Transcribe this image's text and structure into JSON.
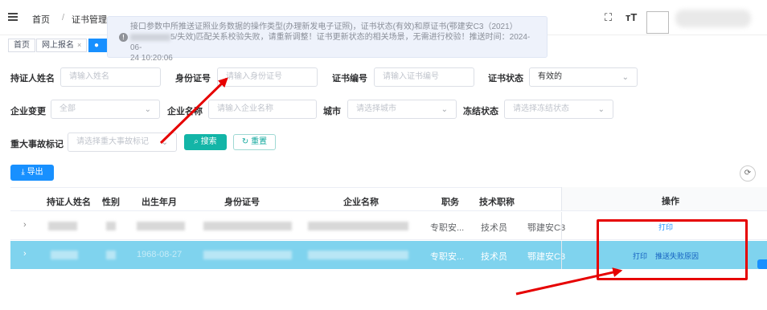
{
  "header": {
    "breadcrumb": [
      "首页",
      "/",
      "证书管理"
    ],
    "fullscreen_icon": "fullscreen-icon",
    "font_size_icon": "font-size-icon"
  },
  "tags": [
    {
      "label": "首页"
    },
    {
      "label": "网上报名",
      "close": "×"
    },
    {
      "label": "●"
    }
  ],
  "notification": {
    "line1": "接口参数中所推送证照业务数据的操作类型(办理新发电子证照)，证书状态(有效)和原证书(",
    "line1_tail": "鄂建安C3（2021）",
    "line2": "5/失效)匹配关系校验失败，请重新调整！证书更新状态的相关场景，无需进行校验！推送时间：2024-06-",
    "line3": "24 10:20:06"
  },
  "search": {
    "holder_name_label": "持证人姓名",
    "holder_name_placeholder": "请输入姓名",
    "id_label": "身份证号",
    "id_placeholder": "请输入身份证号",
    "cert_no_label": "证书编号",
    "cert_no_placeholder": "请输入证书编号",
    "cert_status_label": "证书状态",
    "cert_status_value": "有效的",
    "company_change_label": "企业变更",
    "company_change_value": "全部",
    "company_name_label": "企业名称",
    "company_name_placeholder": "请输入企业名称",
    "city_label": "城市",
    "city_placeholder": "请选择城市",
    "freeze_label": "冻结状态",
    "freeze_placeholder": "请选择冻结状态",
    "accident_label": "重大事故标记",
    "accident_placeholder": "请选择重大事故标记",
    "search_button": "搜索",
    "reset_button": "重置"
  },
  "toolbar": {
    "export_button": "导出"
  },
  "table": {
    "columns": [
      "持证人姓名",
      "性别",
      "出生年月",
      "身份证号",
      "企业名称",
      "职务",
      "技术职称",
      "操作"
    ],
    "rows": [
      {
        "position": "专职安...",
        "title": "技术员",
        "cert": "鄂建安C3",
        "actions": [
          "打印"
        ]
      },
      {
        "position": "专职安...",
        "title": "技术员",
        "cert": "鄂建安C3",
        "birth": "1968-08-27",
        "actions": [
          "打印",
          "推送失败原因"
        ]
      }
    ]
  },
  "colors": {
    "primary": "#1890ff",
    "teal": "#13b5a7",
    "highlight_row": "#7fd3ee",
    "annotation_red": "#e60000"
  }
}
